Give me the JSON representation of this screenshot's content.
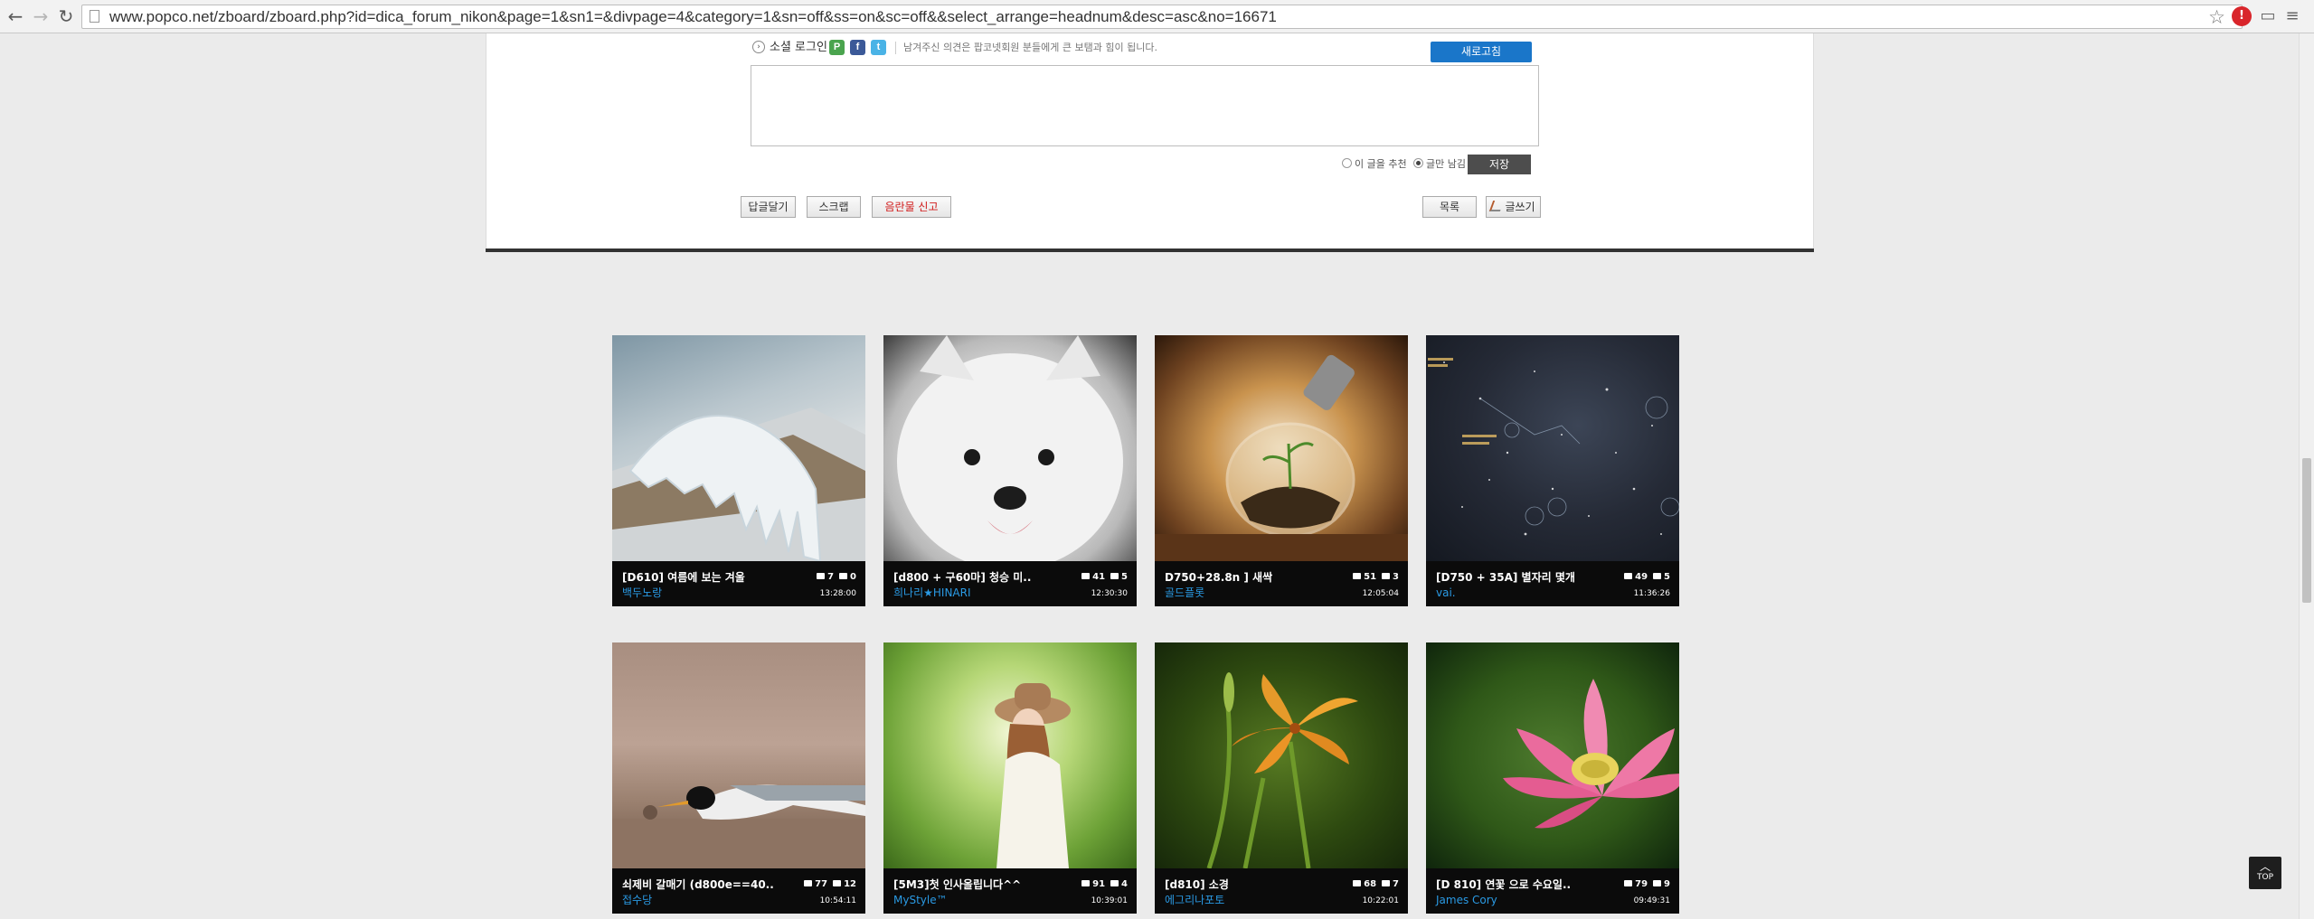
{
  "browser": {
    "url": "www.popco.net/zboard/zboard.php?id=dica_forum_nikon&page=1&sn1=&divpage=4&category=1&sn=off&ss=on&sc=off&&select_arrange=headnum&desc=asc&no=16671"
  },
  "comment_form": {
    "social_login_label": "소셜 로그인",
    "notice": "남겨주신 의견은 팝코넷회원 분들에게 큰 보탬과 힘이 됩니다.",
    "refresh_label": "새로고침",
    "radio_recommend": "이 글을 추천",
    "radio_me": "글만 남김",
    "save_label": "저장"
  },
  "actions": {
    "reply": "답글달기",
    "scrap": "스크랩",
    "report": "음란물 신고",
    "list": "목록",
    "write": "글쓰기"
  },
  "gallery": [
    {
      "title": "[D610] 여름에 보는 겨울",
      "views": "7",
      "comments": "0",
      "author": "백두노랑",
      "time": "13:28:00"
    },
    {
      "title": "[d800 + 구60마] 청승 미..",
      "views": "41",
      "comments": "5",
      "author": "희나리★HINARI",
      "time": "12:30:30"
    },
    {
      "title": "D750+28.8n ] 새싹",
      "views": "51",
      "comments": "3",
      "author": "골드플롯",
      "time": "12:05:04"
    },
    {
      "title": "[D750 + 35A] 별자리 몇개",
      "views": "49",
      "comments": "5",
      "author": "vai.",
      "time": "11:36:26"
    },
    {
      "title": "쇠제비 갈매기 (d800e==40..",
      "views": "77",
      "comments": "12",
      "author": "접수당",
      "time": "10:54:11"
    },
    {
      "title": "[5M3]첫 인사올립니다^^",
      "views": "91",
      "comments": "4",
      "author": "MyStyle™",
      "time": "10:39:01"
    },
    {
      "title": "[d810] 소경",
      "views": "68",
      "comments": "7",
      "author": "에그리나포토",
      "time": "10:22:01"
    },
    {
      "title": "[D 810] 연꽃 으로 수요일..",
      "views": "79",
      "comments": "9",
      "author": "James Cory",
      "time": "09:49:31"
    }
  ],
  "top_button": "TOP"
}
